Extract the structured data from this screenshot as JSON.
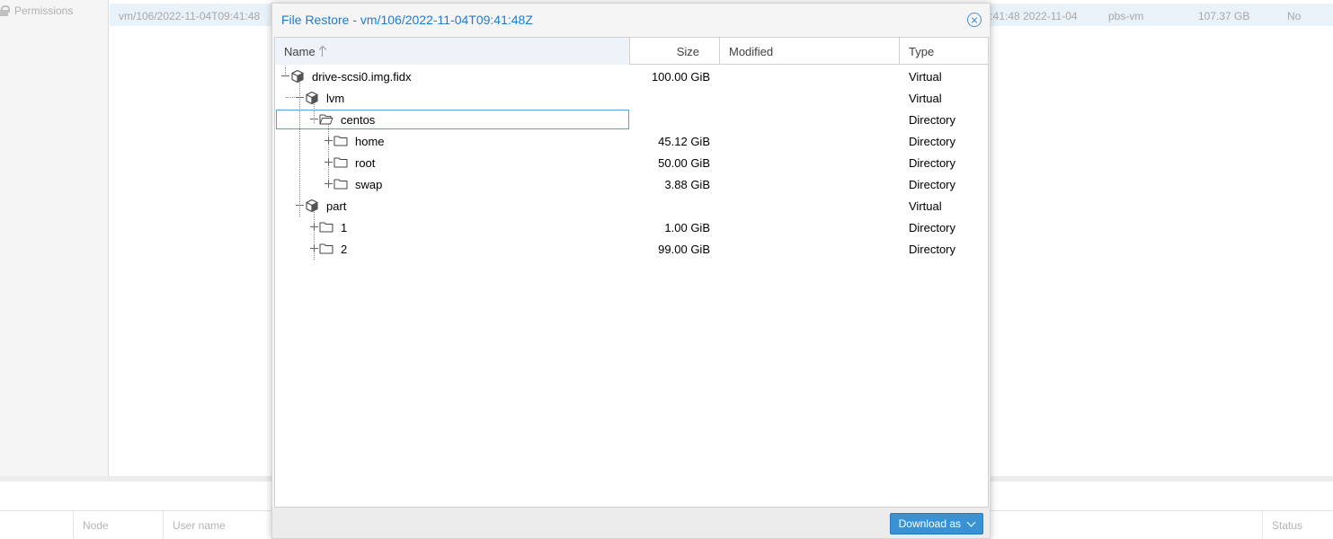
{
  "background": {
    "sidebar_item": "Permissions",
    "backup_row": {
      "volume": "vm/106/2022-11-04T09:41:48",
      "date": "2022-11-04 12:41:48",
      "storage": "pbs-vm",
      "size": "107.37 GB",
      "encrypted": "No"
    },
    "bottom_columns": [
      "Node",
      "User name",
      "Status"
    ]
  },
  "window": {
    "title": "File Restore - vm/106/2022-11-04T09:41:48Z",
    "columns": {
      "name": "Name",
      "size": "Size",
      "modified": "Modified",
      "type": "Type"
    },
    "rows": [
      {
        "name": "drive-scsi0.img.fidx",
        "size": "100.00 GiB",
        "modified": "",
        "type": "Virtual",
        "icon": "cube-icon",
        "expanded": true
      },
      {
        "name": "lvm",
        "size": "",
        "modified": "",
        "type": "Virtual",
        "icon": "cube-icon",
        "expanded": true
      },
      {
        "name": "centos",
        "size": "",
        "modified": "",
        "type": "Directory",
        "icon": "folder-open-icon",
        "expanded": true,
        "selected": true
      },
      {
        "name": "home",
        "size": "45.12 GiB",
        "modified": "",
        "type": "Directory",
        "icon": "folder-icon",
        "expanded": false
      },
      {
        "name": "root",
        "size": "50.00 GiB",
        "modified": "",
        "type": "Directory",
        "icon": "folder-icon",
        "expanded": false
      },
      {
        "name": "swap",
        "size": "3.88 GiB",
        "modified": "",
        "type": "Directory",
        "icon": "folder-icon",
        "expanded": false
      },
      {
        "name": "part",
        "size": "",
        "modified": "",
        "type": "Virtual",
        "icon": "cube-icon",
        "expanded": true
      },
      {
        "name": "1",
        "size": "1.00 GiB",
        "modified": "",
        "type": "Directory",
        "icon": "folder-icon",
        "expanded": false
      },
      {
        "name": "2",
        "size": "99.00 GiB",
        "modified": "",
        "type": "Directory",
        "icon": "folder-icon",
        "expanded": false
      }
    ],
    "download_button": "Download as",
    "colors": {
      "accent": "#1f7ccc",
      "button": "#3892d4",
      "selection_border": "#5f9ad3"
    }
  }
}
